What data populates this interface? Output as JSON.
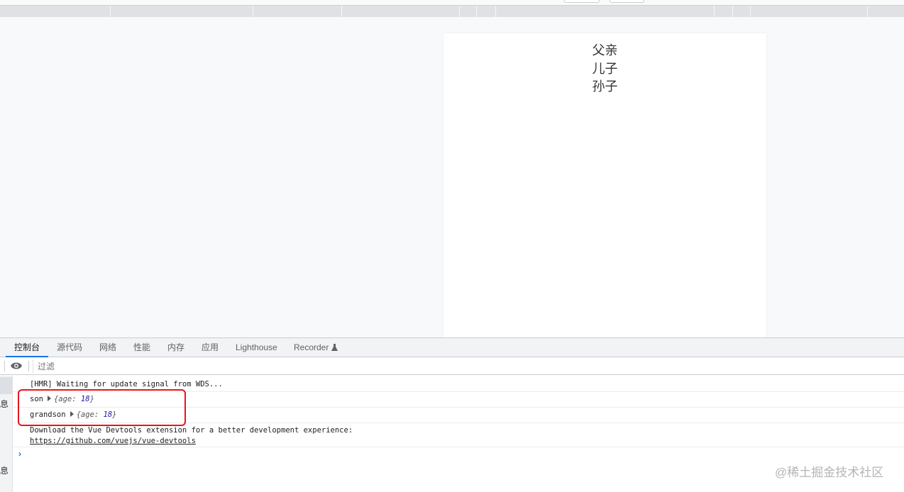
{
  "page": {
    "lines": [
      "父亲",
      "儿子",
      "孙子"
    ]
  },
  "devtools": {
    "tabs": [
      {
        "label": "控制台",
        "active": true
      },
      {
        "label": "源代码"
      },
      {
        "label": "网络"
      },
      {
        "label": "性能"
      },
      {
        "label": "内存"
      },
      {
        "label": "应用"
      },
      {
        "label": "Lighthouse"
      },
      {
        "label": "Recorder"
      }
    ],
    "recorder_icon": "flask-icon",
    "filter_placeholder": "过滤",
    "sidebar_labels": [
      "息",
      "息"
    ],
    "console": [
      {
        "text": "[HMR] Waiting for update signal from WDS..."
      },
      {
        "label": "son",
        "object_open": "{age: ",
        "value": "18",
        "object_close": "}"
      },
      {
        "label": "grandson",
        "object_open": "{age: ",
        "value": "18",
        "object_close": "}"
      },
      {
        "text": "Download the Vue Devtools extension for a better development experience:",
        "link": "https://github.com/vuejs/vue-devtools"
      }
    ],
    "prompt": "›"
  },
  "highlight_color": "#e8141b",
  "watermark": "@稀土掘金技术社区"
}
